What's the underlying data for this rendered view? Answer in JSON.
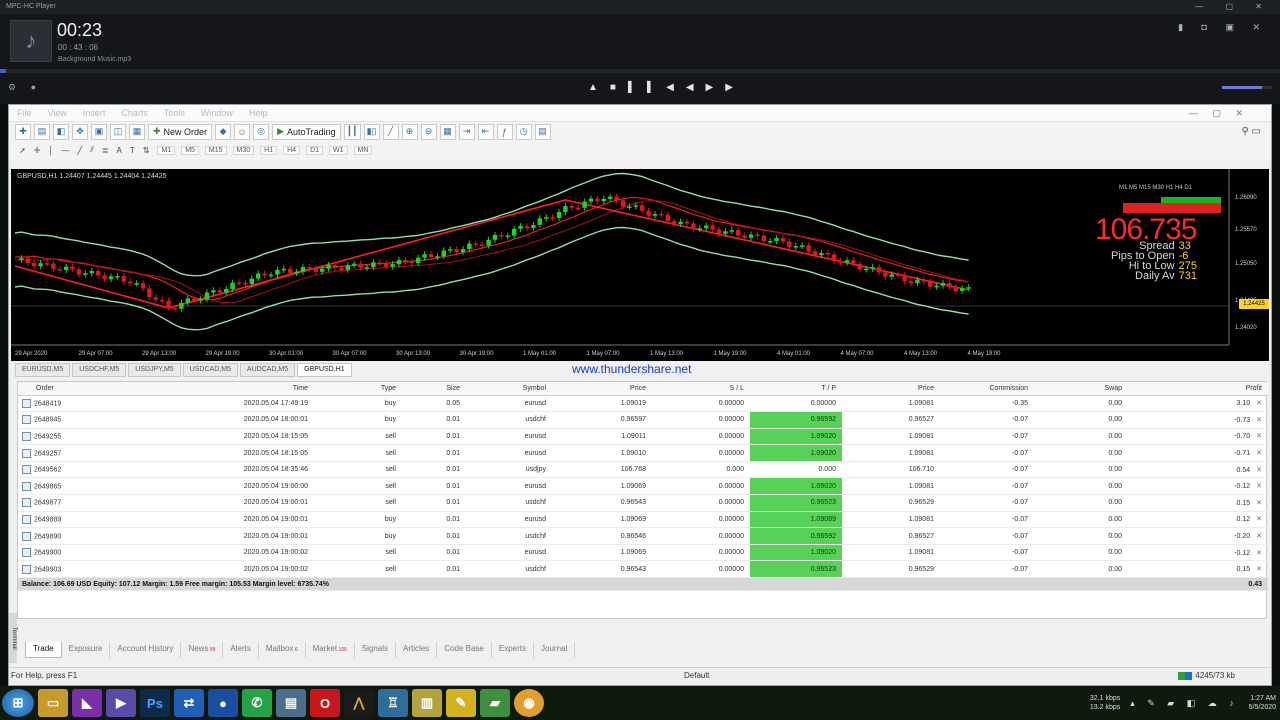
{
  "player": {
    "title": "MPC-HC Player",
    "time": "00:23",
    "length": "00 : 43 : 06",
    "track": "Background Music.mp3",
    "progress": 0.005,
    "controls": [
      "▲",
      "■",
      "▌▌",
      "◀◀",
      "▶▶"
    ]
  },
  "menu": [
    "File",
    "View",
    "Insert",
    "Charts",
    "Tools",
    "Window",
    "Help"
  ],
  "toolbar": {
    "new_order": "New Order",
    "autotrading": "AutoTrading"
  },
  "timeframes": [
    "M1",
    "M5",
    "M15",
    "M30",
    "H1",
    "H4",
    "D1",
    "W1",
    "MN"
  ],
  "chart": {
    "symbol_header": "GBPUSD,H1  1.24407 1.24445 1.24404 1.24425",
    "big_price": "106.735",
    "info": [
      {
        "label": "Spread",
        "value": "33"
      },
      {
        "label": "Pips to Open",
        "value": "-6"
      },
      {
        "label": "Hi to Low",
        "value": "275"
      },
      {
        "label": "Daily Av",
        "value": "731"
      }
    ],
    "y_ticks": [
      "1.26090",
      "1.25570",
      "1.25050",
      "1.24425",
      "1.24020"
    ],
    "x_ticks": [
      "29 Apr 2020",
      "29 Apr 07:00",
      "29 Apr 13:00",
      "29 Apr 19:00",
      "30 Apr 01:00",
      "30 Apr 07:00",
      "30 Apr 13:00",
      "30 Apr 19:00",
      "1 May 01:00",
      "1 May 07:00",
      "1 May 13:00",
      "1 May 19:00",
      "4 May 01:00",
      "4 May 07:00",
      "4 May 13:00",
      "4 May 19:00"
    ],
    "price_tag": "1.24425"
  },
  "chart_tabs": [
    "EURUSD,M5",
    "USDCHF,M5",
    "USDJPY,M5",
    "USDCAD,M5",
    "AUDCAD,M5",
    "GBPUSD,H1"
  ],
  "active_chart_tab": 5,
  "watermark": "www.thundershare.net",
  "orders": {
    "columns": [
      "Order",
      "Time",
      "Type",
      "Size",
      "Symbol",
      "Price",
      "S / L",
      "T / P",
      "Price",
      "Commission",
      "Swap",
      "Profit"
    ],
    "rows": [
      [
        "2648419",
        "2020.05.04 17:49:19",
        "buy",
        "0.05",
        "eurusd",
        "1.09019",
        "0.00000",
        "0.00000",
        "1.09081",
        "-0.35",
        "0.00",
        "3.10"
      ],
      [
        "2648945",
        "2020.05.04 18:00:01",
        "buy",
        "0.01",
        "usdchf",
        "0.96597",
        "0.00000",
        "0.96592",
        "0.96527",
        "-0.07",
        "0.00",
        "-0.73"
      ],
      [
        "2649255",
        "2020.05.04 18:15:05",
        "sell",
        "0.01",
        "eurusd",
        "1.09011",
        "0.00000",
        "1.09020",
        "1.09081",
        "-0.07",
        "0.00",
        "-0.70"
      ],
      [
        "2649257",
        "2020.05.04 18:15:05",
        "sell",
        "0.01",
        "eurusd",
        "1.09010",
        "0.00000",
        "1.09020",
        "1.09081",
        "-0.07",
        "0.00",
        "-0.71"
      ],
      [
        "2649562",
        "2020.05.04 18:35:46",
        "sell",
        "0.01",
        "usdjpy",
        "106.768",
        "0.000",
        "0.000",
        "106.710",
        "-0.07",
        "0.00",
        "0.54"
      ],
      [
        "2649865",
        "2020.05.04 19:00:00",
        "sell",
        "0.01",
        "eurusd",
        "1.09069",
        "0.00000",
        "1.09020",
        "1.09081",
        "-0.07",
        "0.00",
        "-0.12"
      ],
      [
        "2649877",
        "2020.05.04 19:00:01",
        "sell",
        "0.01",
        "usdchf",
        "0.96543",
        "0.00000",
        "0.96523",
        "0.96529",
        "-0.07",
        "0.00",
        "0.15"
      ],
      [
        "2649889",
        "2020.05.04 19:00:01",
        "buy",
        "0.01",
        "eurusd",
        "1.09069",
        "0.00000",
        "1.09089",
        "1.09081",
        "-0.07",
        "0.00",
        "0.12"
      ],
      [
        "2649890",
        "2020.05.04 19:00:01",
        "buy",
        "0.01",
        "usdchf",
        "0.96546",
        "0.00000",
        "0.96592",
        "0.96527",
        "-0.07",
        "0.00",
        "-0.20"
      ],
      [
        "2649900",
        "2020.05.04 19:00:02",
        "sell",
        "0.01",
        "eurusd",
        "1.09069",
        "0.00000",
        "1.09020",
        "1.09081",
        "-0.07",
        "0.00",
        "-0.12"
      ],
      [
        "2649903",
        "2020.05.04 19:00:02",
        "sell",
        "0.01",
        "usdchf",
        "0.96543",
        "0.00000",
        "0.96523",
        "0.96529",
        "-0.07",
        "0.00",
        "0.15"
      ]
    ],
    "tp_highlight": [
      false,
      true,
      true,
      true,
      false,
      true,
      true,
      true,
      true,
      true,
      true
    ],
    "balance_line": "Balance: 106.69 USD  Equity: 107.12  Margin: 1.59  Free margin: 105.53  Margin level: 6735.74%",
    "balance_profit": "0.43"
  },
  "terminal_tabs": [
    {
      "label": "Trade",
      "badge": ""
    },
    {
      "label": "Exposure",
      "badge": ""
    },
    {
      "label": "Account History",
      "badge": ""
    },
    {
      "label": "News",
      "badge": "99"
    },
    {
      "label": "Alerts",
      "badge": ""
    },
    {
      "label": "Mailbox",
      "badge": "6"
    },
    {
      "label": "Market",
      "badge": "106"
    },
    {
      "label": "Signals",
      "badge": ""
    },
    {
      "label": "Articles",
      "badge": ""
    },
    {
      "label": "Code Base",
      "badge": ""
    },
    {
      "label": "Experts",
      "badge": ""
    },
    {
      "label": "Journal",
      "badge": ""
    }
  ],
  "terminal_side": "Terminal",
  "status": {
    "help": "For Help, press F1",
    "profile": "Default",
    "traffic": "4245/73 kb"
  },
  "taskbar": {
    "net_up": "32.1 kbps",
    "net_down": "13.2 kbps",
    "time": "1:27 AM",
    "date": "5/5/2020"
  },
  "colors": {
    "bull": "#1fd61f",
    "bear": "#e01818",
    "band": "#8fe0a8",
    "ma": "#e82020",
    "tp_green": "#57d157"
  }
}
